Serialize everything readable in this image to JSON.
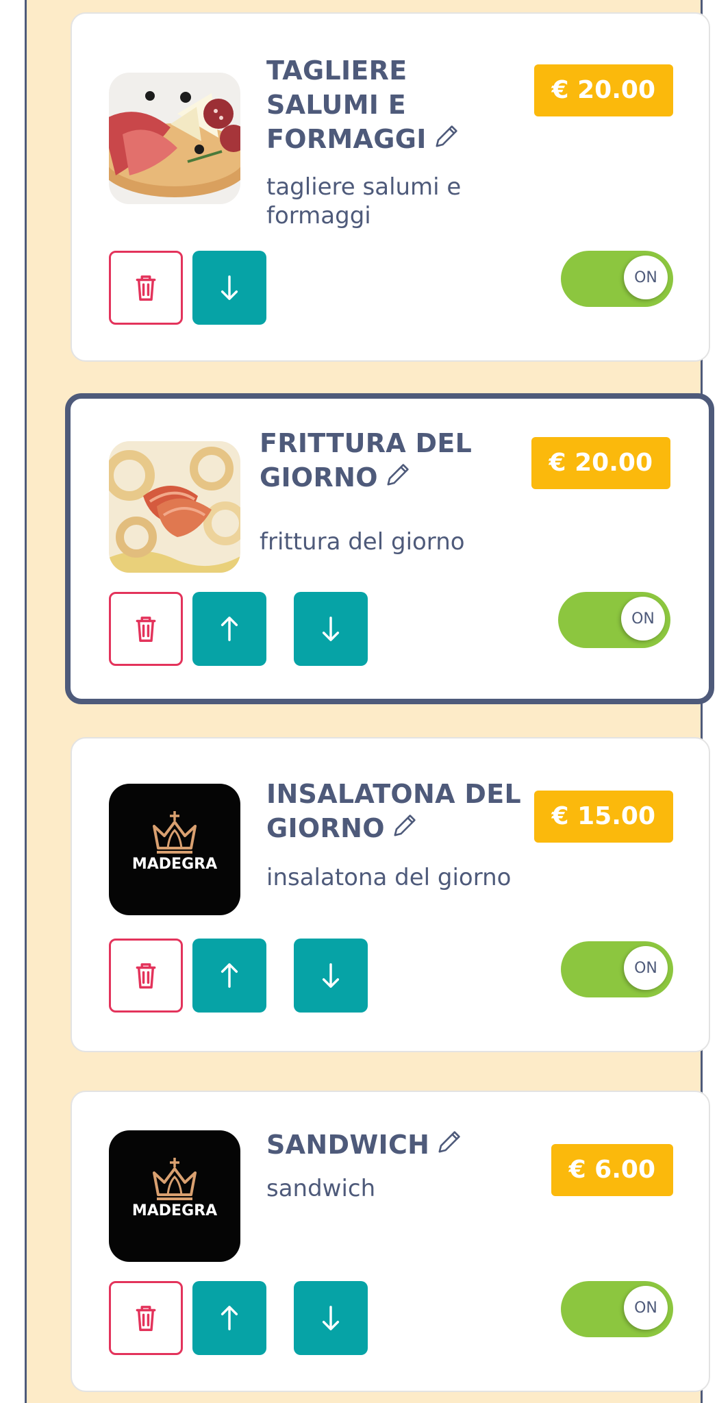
{
  "colors": {
    "background": "#fdebc8",
    "frame": "#4e5a7a",
    "text": "#4e5a7a",
    "price_badge": "#fbb90c",
    "delete_border": "#e3335b",
    "move_button": "#06a3a6",
    "toggle_on": "#8cc63f"
  },
  "items": [
    {
      "title": "TAGLIERE SALUMI E FORMAGGI",
      "description": "tagliere salumi e formaggi",
      "price": "€ 20.00",
      "image": "charcuterie-board-photo",
      "toggle_label": "ON",
      "enabled": true,
      "selected": false,
      "actions": [
        "delete",
        "move-down"
      ]
    },
    {
      "title": "FRITTURA DEL GIORNO",
      "description": "frittura del giorno",
      "price": "€ 20.00",
      "image": "fried-seafood-photo",
      "toggle_label": "ON",
      "enabled": true,
      "selected": true,
      "actions": [
        "delete",
        "move-up",
        "move-down"
      ]
    },
    {
      "title": "INSALATONA DEL GIORNO",
      "description": "insalatona del giorno",
      "price": "€ 15.00",
      "image": "madegra-logo",
      "logo_text": "MADEGRA",
      "toggle_label": "ON",
      "enabled": true,
      "selected": false,
      "actions": [
        "delete",
        "move-up",
        "move-down"
      ]
    },
    {
      "title": "SANDWICH",
      "description": "sandwich",
      "price": "€ 6.00",
      "image": "madegra-logo",
      "logo_text": "MADEGRA",
      "toggle_label": "ON",
      "enabled": true,
      "selected": false,
      "actions": [
        "delete",
        "move-up",
        "move-down"
      ]
    }
  ],
  "icons": {
    "edit": "pencil-icon",
    "delete": "trash-icon",
    "move_up": "arrow-up-icon",
    "move_down": "arrow-down-icon"
  }
}
